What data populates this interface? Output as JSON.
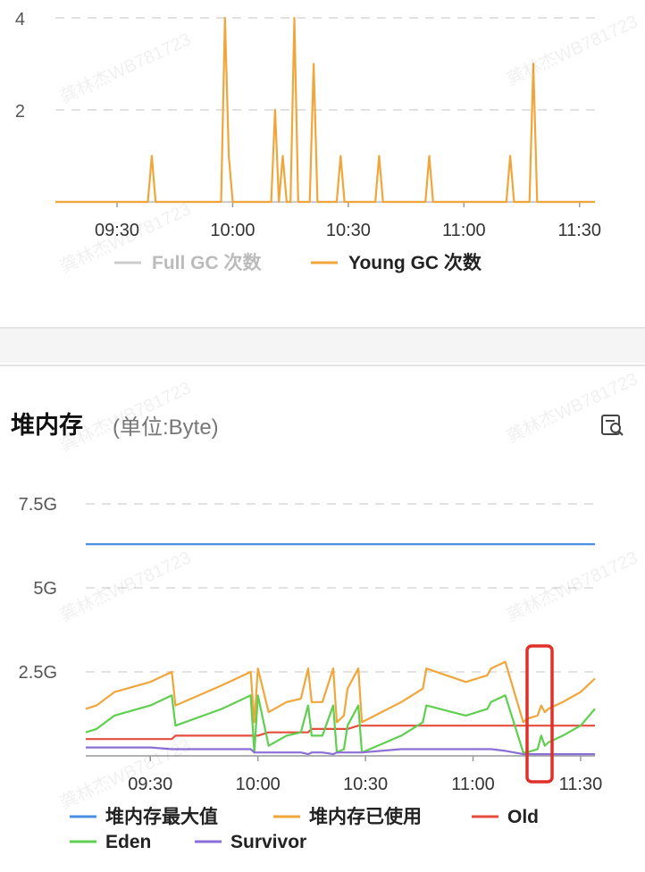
{
  "gc_chart": {
    "legend": [
      {
        "label": "Full GC 次数",
        "color": "#cccccc",
        "active": false
      },
      {
        "label": "Young GC 次数",
        "color": "#f0a63a",
        "active": true
      }
    ],
    "y_ticks": [
      "2",
      "4"
    ],
    "x_ticks": [
      "09:30",
      "10:00",
      "10:30",
      "11:00",
      "11:30"
    ]
  },
  "heap": {
    "title": "堆内存",
    "unit": "(单位:Byte)",
    "y_ticks": [
      "2.5G",
      "5G",
      "7.5G"
    ],
    "x_ticks": [
      "09:30",
      "10:00",
      "10:30",
      "11:00",
      "11:30"
    ],
    "legend": [
      {
        "label": "堆内存最大值",
        "color": "#4a90e2"
      },
      {
        "label": "堆内存已使用",
        "color": "#f0a63a"
      },
      {
        "label": "Old",
        "color": "#e64d3d"
      },
      {
        "label": "Eden",
        "color": "#5fcf4f"
      },
      {
        "label": "Survivor",
        "color": "#8a6fd6"
      }
    ]
  },
  "watermark": "龚林杰WB781723",
  "chart_data": [
    {
      "type": "line",
      "title": "",
      "xlabel": "",
      "ylabel": "",
      "ylim": [
        0,
        4
      ],
      "x": [
        "09:14",
        "09:38",
        "09:39",
        "09:40",
        "09:57",
        "09:58",
        "09:59",
        "10:00",
        "10:10",
        "10:11",
        "10:12",
        "10:13",
        "10:14",
        "10:15",
        "10:16",
        "10:17",
        "10:18",
        "10:20",
        "10:21",
        "10:22",
        "10:27",
        "10:28",
        "10:29",
        "10:37",
        "10:38",
        "10:39",
        "10:50",
        "10:51",
        "10:52",
        "11:11",
        "11:12",
        "11:13",
        "11:17",
        "11:18",
        "11:19",
        "11:34"
      ],
      "series": [
        {
          "name": "Full GC 次数",
          "values": [
            0,
            0,
            0,
            0,
            0,
            0,
            0,
            0,
            0,
            0,
            0,
            0,
            0,
            0,
            0,
            0,
            0,
            0,
            0,
            0,
            0,
            0,
            0,
            0,
            0,
            0,
            0,
            0,
            0,
            0,
            0,
            0,
            0,
            0,
            0,
            0
          ]
        },
        {
          "name": "Young GC 次数",
          "values": [
            0,
            0,
            1,
            0,
            0,
            4,
            1,
            0,
            0,
            2,
            0,
            1,
            0,
            0,
            4,
            0,
            0,
            0,
            3,
            0,
            0,
            1,
            0,
            0,
            1,
            0,
            0,
            1,
            0,
            0,
            1,
            0,
            0,
            3,
            0,
            0
          ]
        }
      ]
    },
    {
      "type": "line",
      "title": "堆内存",
      "xlabel": "",
      "ylabel": "(单位:Byte)",
      "ylim": [
        0,
        8.5
      ],
      "y_unit": "G",
      "x": [
        "09:12",
        "09:15",
        "09:20",
        "09:30",
        "09:36",
        "09:37",
        "09:50",
        "09:58",
        "09:59",
        "10:00",
        "10:03",
        "10:08",
        "10:12",
        "10:14",
        "10:15",
        "10:18",
        "10:21",
        "10:22",
        "10:24",
        "10:25",
        "10:28",
        "10:29",
        "10:40",
        "10:46",
        "10:47",
        "10:58",
        "11:04",
        "11:05",
        "11:09",
        "11:14",
        "11:15",
        "11:18",
        "11:19",
        "11:20",
        "11:21",
        "11:25",
        "11:30",
        "11:34"
      ],
      "series": [
        {
          "name": "堆内存最大值",
          "values": [
            6.3,
            6.3,
            6.3,
            6.3,
            6.3,
            6.3,
            6.3,
            6.3,
            6.3,
            6.3,
            6.3,
            6.3,
            6.3,
            6.3,
            6.3,
            6.3,
            6.3,
            6.3,
            6.3,
            6.3,
            6.3,
            6.3,
            6.3,
            6.3,
            6.3,
            6.3,
            6.3,
            6.3,
            6.3,
            6.3,
            6.3,
            6.3,
            6.3,
            6.3,
            6.3,
            6.3,
            6.3,
            6.3
          ]
        },
        {
          "name": "堆内存已使用",
          "values": [
            1.4,
            1.5,
            1.9,
            2.2,
            2.5,
            1.5,
            2.1,
            2.5,
            1.0,
            2.6,
            1.3,
            1.6,
            1.7,
            2.6,
            1.6,
            1.6,
            2.6,
            1.0,
            1.2,
            2.0,
            2.6,
            1.0,
            1.6,
            2.0,
            2.6,
            2.2,
            2.4,
            2.6,
            2.8,
            1.0,
            1.1,
            1.2,
            1.5,
            1.3,
            1.4,
            1.6,
            1.9,
            2.3
          ]
        },
        {
          "name": "Old",
          "values": [
            0.5,
            0.5,
            0.5,
            0.5,
            0.5,
            0.6,
            0.6,
            0.6,
            0.6,
            0.6,
            0.7,
            0.7,
            0.7,
            0.7,
            0.8,
            0.8,
            0.8,
            0.8,
            0.8,
            0.8,
            0.9,
            0.9,
            0.9,
            0.9,
            0.9,
            0.9,
            0.9,
            0.9,
            0.9,
            0.9,
            0.9,
            0.9,
            0.9,
            0.9,
            0.9,
            0.9,
            0.9,
            0.9
          ]
        },
        {
          "name": "Eden",
          "values": [
            0.7,
            0.8,
            1.2,
            1.5,
            1.8,
            0.9,
            1.4,
            1.8,
            0.1,
            1.8,
            0.3,
            0.6,
            0.7,
            1.5,
            0.6,
            0.6,
            1.5,
            0.1,
            0.2,
            0.9,
            1.5,
            0.1,
            0.6,
            1.0,
            1.5,
            1.2,
            1.4,
            1.6,
            1.8,
            0.1,
            0.1,
            0.2,
            0.6,
            0.3,
            0.4,
            0.6,
            0.9,
            1.4
          ]
        },
        {
          "name": "Survivor",
          "values": [
            0.25,
            0.25,
            0.25,
            0.25,
            0.2,
            0.2,
            0.2,
            0.2,
            0.1,
            0.1,
            0.1,
            0.1,
            0.1,
            0.05,
            0.1,
            0.1,
            0.05,
            0.1,
            0.1,
            0.1,
            0.1,
            0.1,
            0.2,
            0.2,
            0.2,
            0.2,
            0.2,
            0.2,
            0.15,
            0.05,
            0.05,
            0.05,
            0.05,
            0.05,
            0.05,
            0.05,
            0.05,
            0.05
          ]
        }
      ]
    }
  ]
}
